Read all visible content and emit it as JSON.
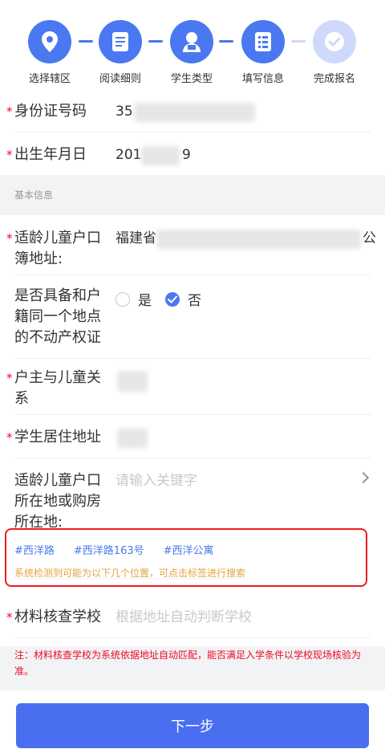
{
  "steps": [
    {
      "label": "选择辖区",
      "icon": "location-pin-icon",
      "state": "done"
    },
    {
      "label": "阅读细则",
      "icon": "document-icon",
      "state": "done"
    },
    {
      "label": "学生类型",
      "icon": "student-icon",
      "state": "done"
    },
    {
      "label": "填写信息",
      "icon": "form-icon",
      "state": "active"
    },
    {
      "label": "完成报名",
      "icon": "check-icon",
      "state": "pending"
    }
  ],
  "form": {
    "id_number": {
      "label": "身份证号码",
      "value": "35"
    },
    "birth_date": {
      "label": "出生年月日",
      "value_prefix": "201",
      "value_suffix": "9"
    },
    "section_basic": "基本信息",
    "household_address": {
      "label": "适龄儿童户口簿地址:",
      "value_prefix": "福建省",
      "value_suffix": "公"
    },
    "property_cert": {
      "label": "是否具备和户籍同一个地点的不动产权证",
      "option_yes": "是",
      "option_no": "否",
      "selected": "否"
    },
    "relation": {
      "label": "户主与儿童关系"
    },
    "residence": {
      "label": "学生居住地址"
    },
    "location": {
      "label": "适龄儿童户口所在地或购房所在地:",
      "placeholder": "请输入关键字"
    },
    "suggestion_tags": [
      "#西洋路",
      "#西洋路163号",
      "#西洋公寓"
    ],
    "suggestion_hint": "系统检测到可能为以下几个位置，可点击标签进行搜索",
    "school": {
      "label": "材料核查学校",
      "placeholder": "根据地址自动判断学校"
    },
    "note": "注：材料核查学校为系统依据地址自动匹配，能否满足入学条件以学校现场核验为准。"
  },
  "footer": {
    "next_label": "下一步"
  },
  "colors": {
    "accent": "#4a78f0",
    "required": "#ee0a24",
    "hint": "#e6a23c",
    "highlight_border": "#ee1c1c"
  }
}
